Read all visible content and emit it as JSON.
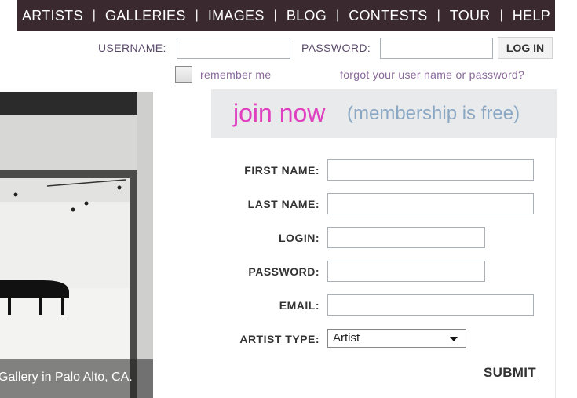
{
  "nav": {
    "items": [
      "ARTISTS",
      "GALLERIES",
      "IMAGES",
      "BLOG",
      "CONTESTS",
      "TOUR",
      "HELP"
    ],
    "separator": "|",
    "bg_color": "#3a2a30"
  },
  "login": {
    "username_label": "USERNAME:",
    "username_value": "",
    "password_label": "PASSWORD:",
    "password_value": "",
    "button_label": "LOG IN",
    "remember_label": "remember me",
    "remember_checked": false,
    "forgot_link": "forgot your user name or password?"
  },
  "hero": {
    "caption": "Gallery in Palo Alto, CA."
  },
  "join": {
    "heading": "join now",
    "subheading": "(membership is free)",
    "heading_color": "#e040c0",
    "subheading_color": "#8aa8c4"
  },
  "form": {
    "first_name_label": "FIRST NAME:",
    "last_name_label": "LAST NAME:",
    "login_label": "LOGIN:",
    "password_label": "PASSWORD:",
    "email_label": "EMAIL:",
    "artist_type_label": "ARTIST TYPE:",
    "artist_type_value": "Artist",
    "submit_label": "SUBMIT"
  }
}
